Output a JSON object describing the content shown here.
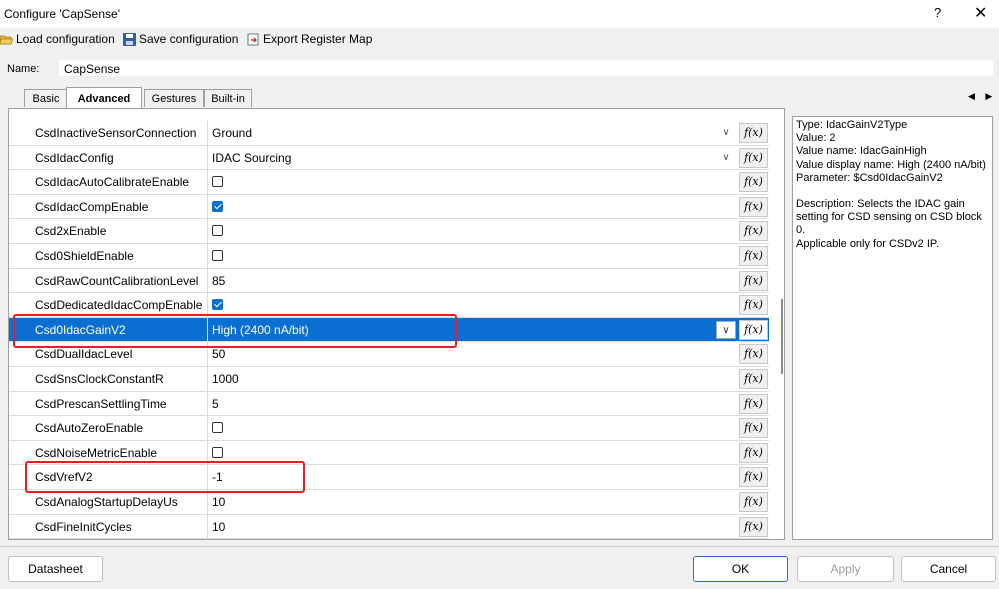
{
  "window": {
    "title": "Configure 'CapSense'",
    "help": "?",
    "close": "✕"
  },
  "toolbar": {
    "load": "Load configuration",
    "save": "Save configuration",
    "export": "Export Register Map"
  },
  "name": {
    "label": "Name:",
    "value": "CapSense"
  },
  "tabs": [
    "Basic",
    "Advanced",
    "Gestures",
    "Built-in"
  ],
  "active_tab": "Advanced",
  "tab_scroll": "◀ ▶",
  "fx_label": "f(x)",
  "rows": [
    {
      "name": "CsdInactiveSensorConnection",
      "value": "Ground",
      "type": "dropdown"
    },
    {
      "name": "CsdIdacConfig",
      "value": "IDAC Sourcing",
      "type": "dropdown"
    },
    {
      "name": "CsdIdacAutoCalibrateEnable",
      "checked": false,
      "type": "checkbox"
    },
    {
      "name": "CsdIdacCompEnable",
      "checked": true,
      "type": "checkbox"
    },
    {
      "name": "Csd2xEnable",
      "checked": false,
      "type": "checkbox"
    },
    {
      "name": "Csd0ShieldEnable",
      "checked": false,
      "type": "checkbox"
    },
    {
      "name": "CsdRawCountCalibrationLevel",
      "value": "85",
      "type": "text"
    },
    {
      "name": "CsdDedicatedIdacCompEnable",
      "checked": true,
      "type": "checkbox"
    },
    {
      "name": "Csd0IdacGainV2",
      "value": "High (2400 nA/bit)",
      "type": "dropdown",
      "selected": true
    },
    {
      "name": "CsdDualIdacLevel",
      "value": "50",
      "type": "text"
    },
    {
      "name": "CsdSnsClockConstantR",
      "value": "1000",
      "type": "text"
    },
    {
      "name": "CsdPrescanSettlingTime",
      "value": "5",
      "type": "text"
    },
    {
      "name": "CsdAutoZeroEnable",
      "checked": false,
      "type": "checkbox"
    },
    {
      "name": "CsdNoiseMetricEnable",
      "checked": false,
      "type": "checkbox"
    },
    {
      "name": "CsdVrefV2",
      "value": "-1",
      "type": "text"
    },
    {
      "name": "CsdAnalogStartupDelayUs",
      "value": "10",
      "type": "text"
    },
    {
      "name": "CsdFineInitCycles",
      "value": "10",
      "type": "text"
    }
  ],
  "description": {
    "type": "Type: IdacGainV2Type",
    "value": "Value: 2",
    "value_name": "Value name: IdacGainHigh",
    "value_display": "Value display name: High (2400 nA/bit)",
    "parameter": "Parameter: $Csd0IdacGainV2",
    "description": "Description: Selects the IDAC gain setting for CSD sensing on CSD block 0.",
    "applicable": "Applicable only for CSDv2 IP."
  },
  "buttons": {
    "datasheet": "Datasheet",
    "ok": "OK",
    "apply": "Apply",
    "cancel": "Cancel"
  },
  "colors": {
    "selection": "#0b6fd1",
    "highlight": "#e32026"
  }
}
